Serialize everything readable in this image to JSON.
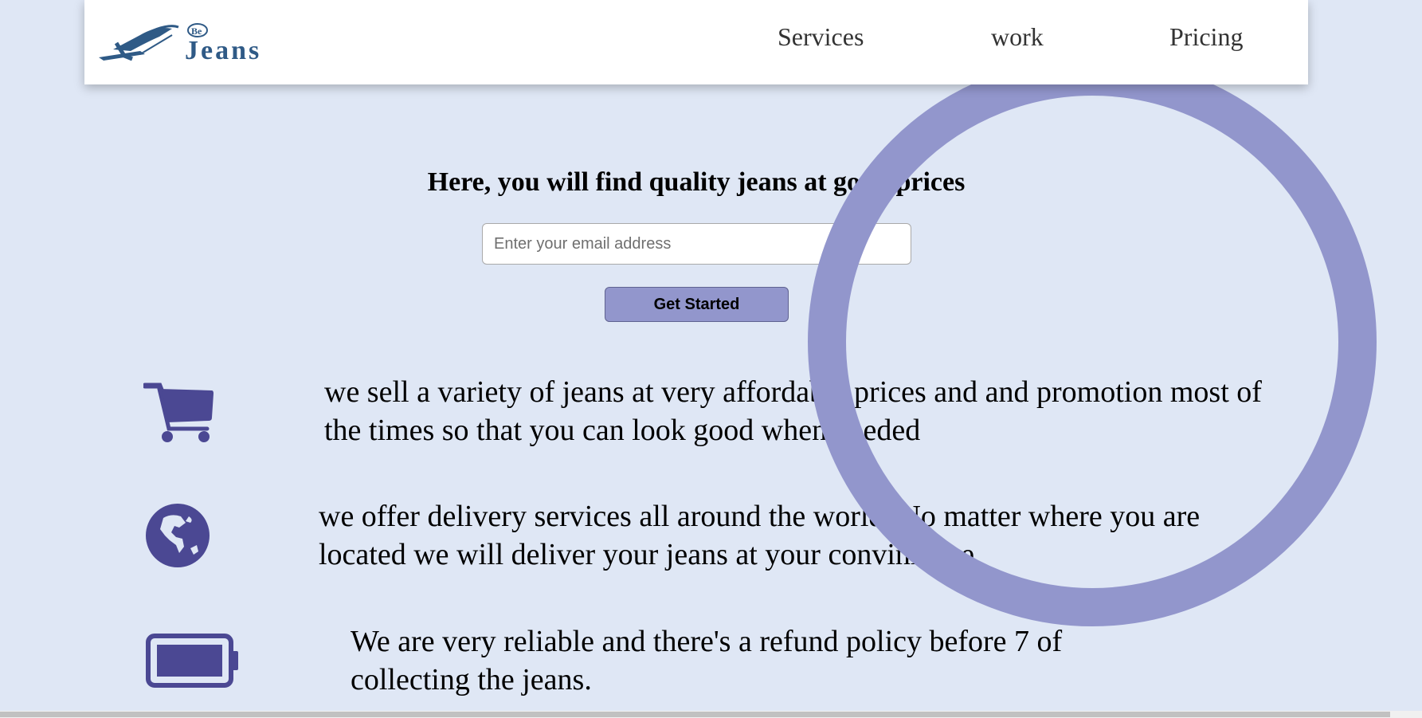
{
  "header": {
    "logo": {
      "small_text": "Be",
      "brand_text": "Jeans"
    },
    "nav": [
      {
        "label": "Services"
      },
      {
        "label": "work"
      },
      {
        "label": "Pricing"
      }
    ]
  },
  "hero": {
    "headline": "Here, you will find quality jeans at good prices",
    "email_placeholder": "Enter your email address",
    "cta_label": "Get Started"
  },
  "features": [
    {
      "icon": "shopping-cart-icon",
      "text": "we sell a variety of jeans at very affordable prices and and promotion most of the times so that you can look good when needed"
    },
    {
      "icon": "globe-icon",
      "text": "we offer delivery services all around the world. No matter where you are located we will deliver your jeans at your convinience"
    },
    {
      "icon": "battery-full-icon",
      "text": "We are very reliable and there's a refund policy before 7 of collecting the jeans."
    }
  ],
  "colors": {
    "background": "#dfe7f5",
    "accent": "#9296cc",
    "icon": "#4b4893",
    "logo": "#2f5a86"
  }
}
